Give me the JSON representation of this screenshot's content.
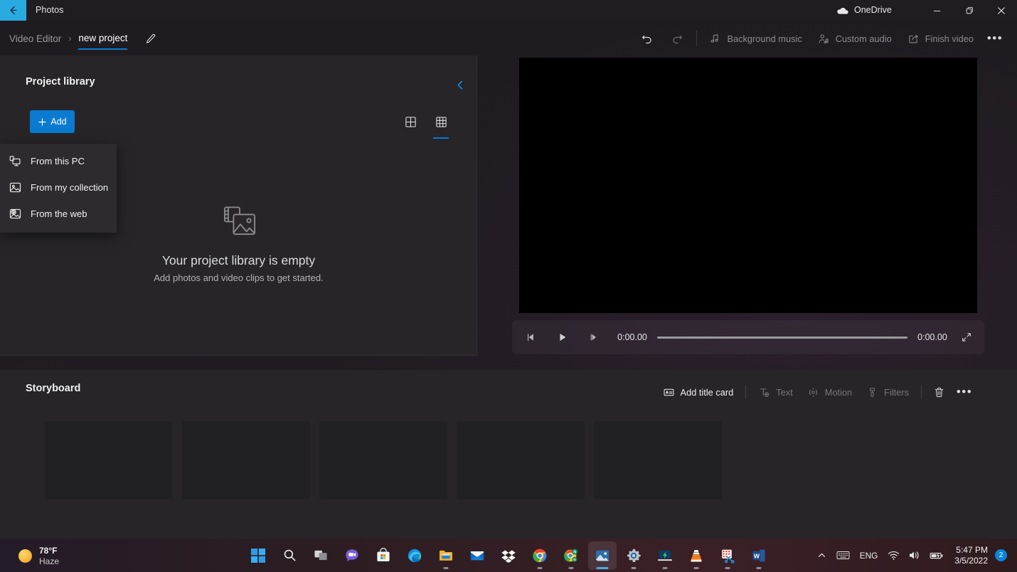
{
  "titlebar": {
    "back_label": "back-arrow",
    "app_title": "Photos",
    "onedrive_label": "OneDrive",
    "minimize": "–",
    "maximize": "❐",
    "close": "✕"
  },
  "commandbar": {
    "breadcrumb_root": "Video Editor",
    "breadcrumb_separator": "›",
    "breadcrumb_current": "new project",
    "rename_icon": "pencil-icon",
    "undo_icon": "undo-icon",
    "redo_icon": "redo-icon",
    "actions": [
      {
        "label": "Background music",
        "icon": "music-note-icon",
        "enabled": false
      },
      {
        "label": "Custom audio",
        "icon": "person-audio-icon",
        "enabled": false
      },
      {
        "label": "Finish video",
        "icon": "export-icon",
        "enabled": false
      }
    ],
    "overflow_label": "•••"
  },
  "library": {
    "title": "Project library",
    "collapse_icon": "chevron-left-icon",
    "add_button_label": "Add",
    "view_large_icon": "grid-large-icon",
    "view_small_icon": "grid-small-icon",
    "view_selected": "grid-small-icon",
    "empty": {
      "icon": "photo-video-stack-icon",
      "title": "Your project library is empty",
      "subtitle": "Add photos and video clips to get started."
    }
  },
  "add_menu": {
    "open": true,
    "items": [
      {
        "label": "From this PC",
        "icon": "monitor-icon"
      },
      {
        "label": "From my collection",
        "icon": "picture-icon"
      },
      {
        "label": "From the web",
        "icon": "web-picture-icon"
      }
    ]
  },
  "preview": {
    "prev_frame_icon": "previous-frame-icon",
    "play_icon": "play-icon",
    "next_frame_icon": "next-frame-icon",
    "current_time": "0:00.00",
    "total_time": "0:00.00",
    "progress_percent": 0,
    "fullscreen_icon": "expand-icon"
  },
  "storyboard": {
    "title": "Storyboard",
    "tools": [
      {
        "label": "Add title card",
        "icon": "title-card-icon",
        "enabled": true
      },
      {
        "label": "Text",
        "icon": "text-add-icon",
        "enabled": false
      },
      {
        "label": "Motion",
        "icon": "motion-icon",
        "enabled": false
      },
      {
        "label": "Filters",
        "icon": "filters-icon",
        "enabled": false
      }
    ],
    "delete_icon": "trash-icon",
    "overflow_label": "•••",
    "card_count": 5
  },
  "taskbar": {
    "weather": {
      "temperature": "78°F",
      "condition": "Haze",
      "icon": "sun-icon"
    },
    "apps": [
      {
        "name": "start-button",
        "icon": "windows-logo-icon",
        "state": "idle"
      },
      {
        "name": "search-button",
        "icon": "search-icon",
        "state": "idle"
      },
      {
        "name": "task-view",
        "icon": "task-view-icon",
        "state": "idle"
      },
      {
        "name": "chat",
        "icon": "chat-icon",
        "state": "idle"
      },
      {
        "name": "microsoft-store",
        "icon": "store-icon",
        "state": "idle"
      },
      {
        "name": "edge",
        "icon": "edge-icon",
        "state": "idle"
      },
      {
        "name": "file-explorer",
        "icon": "folder-icon",
        "state": "running"
      },
      {
        "name": "mail",
        "icon": "mail-icon",
        "state": "idle"
      },
      {
        "name": "dropbox",
        "icon": "dropbox-icon",
        "state": "idle"
      },
      {
        "name": "chrome",
        "icon": "chrome-icon",
        "state": "running"
      },
      {
        "name": "chrome-notion",
        "icon": "chrome-n-icon",
        "state": "running"
      },
      {
        "name": "photos",
        "icon": "photos-icon",
        "state": "active"
      },
      {
        "name": "settings",
        "icon": "settings-gear-icon",
        "state": "running"
      },
      {
        "name": "quick-assist",
        "icon": "lightning-pc-icon",
        "state": "running"
      },
      {
        "name": "vlc",
        "icon": "vlc-cone-icon",
        "state": "running"
      },
      {
        "name": "snipping-tool",
        "icon": "snipping-tool-icon",
        "state": "running"
      },
      {
        "name": "word",
        "icon": "word-icon",
        "state": "running"
      }
    ],
    "tray": {
      "overflow_icon": "chevron-up-icon",
      "keyboard_icon": "keyboard-icon",
      "language": "ENG",
      "wifi_icon": "wifi-icon",
      "volume_icon": "volume-icon",
      "battery_icon": "battery-charging-icon",
      "time": "5:47 PM",
      "date": "3/5/2022",
      "notification_count": "2"
    }
  },
  "colors": {
    "accent_blue": "#0a7bd1",
    "back_button": "#29ABE2",
    "panel": "#272528",
    "menu": "#2d2b2f",
    "card": "#212023"
  }
}
